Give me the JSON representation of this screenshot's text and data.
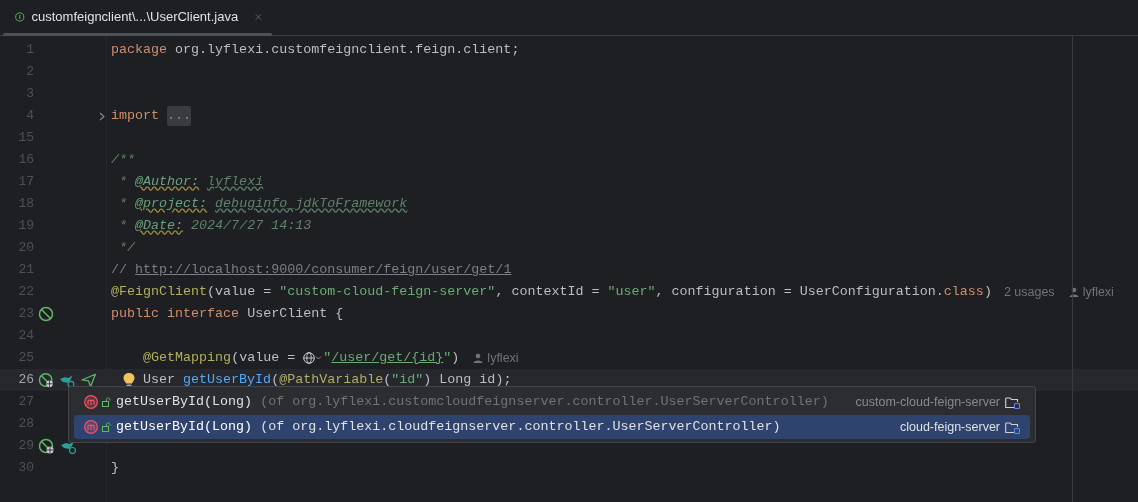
{
  "tab": {
    "title": "customfeignclient\\...\\UserClient.java"
  },
  "editor": {
    "lines": [
      {
        "number": "1",
        "current": false,
        "folded": false,
        "tokens": [
          {
            "kind": "keyword",
            "text": "package "
          },
          {
            "kind": "plain",
            "text": "org.lyflexi.customfeignclient.feign.client;"
          }
        ]
      },
      {
        "number": "2",
        "current": false,
        "folded": false
      },
      {
        "number": "3",
        "current": false,
        "folded": false
      },
      {
        "number": "4",
        "current": false,
        "folded": true,
        "tokens": [
          {
            "kind": "keyword",
            "text": "import "
          },
          {
            "kind": "placeholder",
            "text": "..."
          }
        ]
      },
      {
        "number": "15",
        "current": false,
        "folded": false
      },
      {
        "number": "16",
        "current": false,
        "folded": false,
        "tokens": [
          {
            "kind": "doc",
            "text": "/**"
          }
        ]
      },
      {
        "number": "17",
        "current": false,
        "folded": false,
        "tokens": [
          {
            "kind": "doc",
            "text": " * "
          },
          {
            "kind": "doctag",
            "text": "@Author:"
          },
          {
            "kind": "docvalue",
            "text": "lyflexi"
          }
        ]
      },
      {
        "number": "18",
        "current": false,
        "folded": false,
        "tokens": [
          {
            "kind": "doc",
            "text": " * "
          },
          {
            "kind": "doctag",
            "text": "@project:"
          },
          {
            "kind": "docvalue",
            "text": "debuginfo_jdkToFramework"
          }
        ]
      },
      {
        "number": "19",
        "current": false,
        "folded": false,
        "tokens": [
          {
            "kind": "doc",
            "text": " * "
          },
          {
            "kind": "doctag",
            "text": "@Date:"
          },
          {
            "kind": "doc",
            "text": " 2024/7/27 14:13"
          }
        ]
      },
      {
        "number": "20",
        "current": false,
        "folded": false,
        "tokens": [
          {
            "kind": "doc",
            "text": " */"
          }
        ]
      },
      {
        "number": "21",
        "current": false,
        "folded": false,
        "tokens": [
          {
            "kind": "comment",
            "text": "// "
          },
          {
            "kind": "url",
            "text": "http://localhost:9000/consumer/feign/user/get/1"
          }
        ]
      },
      {
        "number": "22",
        "current": false,
        "folded": false,
        "tokens": [
          {
            "kind": "annotation",
            "text": "@FeignClient"
          },
          {
            "kind": "plain",
            "text": "(value = "
          },
          {
            "kind": "string",
            "text": "\"custom-cloud-feign-server\""
          },
          {
            "kind": "plain",
            "text": ", contextId = "
          },
          {
            "kind": "string",
            "text": "\"user\""
          },
          {
            "kind": "plain",
            "text": ", configuration = UserConfiguration."
          },
          {
            "kind": "keyword",
            "text": "class"
          },
          {
            "kind": "plain",
            "text": ")"
          },
          {
            "kind": "hint",
            "text": "2 usages"
          },
          {
            "kind": "author",
            "text": "lyflexi"
          }
        ]
      },
      {
        "number": "23",
        "current": false,
        "folded": false,
        "icons": [
          {
            "kind": "bean"
          }
        ],
        "tokens": [
          {
            "kind": "keyword",
            "text": "public interface "
          },
          {
            "kind": "plain",
            "text": "UserClient {"
          }
        ]
      },
      {
        "number": "24",
        "current": false,
        "folded": false
      },
      {
        "number": "25",
        "current": false,
        "folded": false,
        "tokens": [
          {
            "kind": "annotation",
            "text": "    @GetMapping"
          },
          {
            "kind": "plain",
            "text": "(value = "
          },
          {
            "kind": "globe"
          },
          {
            "kind": "string",
            "text": "\""
          },
          {
            "kind": "path",
            "text": "/user/get/{id}"
          },
          {
            "kind": "string",
            "text": "\""
          },
          {
            "kind": "plain",
            "text": ")"
          },
          {
            "kind": "author",
            "text": "lyflexi"
          }
        ]
      },
      {
        "number": "26",
        "current": true,
        "folded": false,
        "icons": [
          {
            "kind": "bean-web"
          },
          {
            "kind": "bird"
          },
          {
            "kind": "send"
          }
        ],
        "tokens": [
          {
            "kind": "bulb"
          },
          {
            "kind": "plain",
            "text": "User "
          },
          {
            "kind": "method",
            "text": "getUserById"
          },
          {
            "kind": "plain",
            "text": "("
          },
          {
            "kind": "annotation",
            "text": "@PathVariable"
          },
          {
            "kind": "plain",
            "text": "("
          },
          {
            "kind": "string",
            "text": "\"id\""
          },
          {
            "kind": "plain",
            "text": ") Long id);"
          }
        ]
      },
      {
        "number": "27",
        "current": false,
        "folded": false
      },
      {
        "number": "28",
        "current": false,
        "folded": false
      },
      {
        "number": "29",
        "current": false,
        "folded": false,
        "icons": [
          {
            "kind": "bean-web"
          },
          {
            "kind": "bird"
          }
        ]
      },
      {
        "number": "30",
        "current": false,
        "folded": false,
        "tokens": [
          {
            "kind": "plain",
            "text": "}"
          }
        ]
      }
    ]
  },
  "popup": {
    "items": [
      {
        "name": "getUserById(Long)",
        "detail": "(of org.lyflexi.customcloudfeignserver.controller.UserServerController)",
        "module": "custom-cloud-feign-server",
        "selected": false
      },
      {
        "name": "getUserById(Long)",
        "detail": "(of org.lyflexi.cloudfeignserver.controller.UserServerController)",
        "module": "cloud-feign-server",
        "selected": true
      }
    ]
  }
}
